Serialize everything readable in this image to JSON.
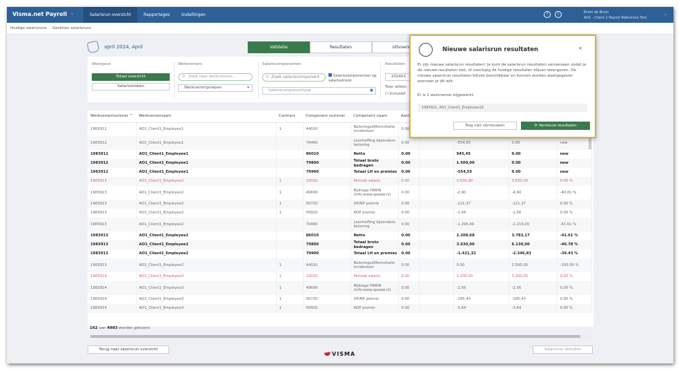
{
  "nav": {
    "brand": "Visma.net Payroll",
    "tabs": [
      "Salarisrun overzicht",
      "Rapportages",
      "Instellingen"
    ],
    "user_name": "Bram de Bruin",
    "user_company": "AO1 - Client 1 Payroll Reference Tool"
  },
  "subnav": [
    "Huidige salarisruns",
    "Gesloten salarisruns"
  ],
  "page": {
    "title": "april 2024, April",
    "tabs": [
      "Validatie",
      "Resultaten",
      "Uitvoering"
    ]
  },
  "filters": {
    "weergave_label": "Weergave",
    "totaal_btn": "Totaal overzicht",
    "salarisstroken_btn": "Salarisstroken",
    "werknemers_label": "Werknemers",
    "werknemers_placeholder": "Zoek naar werknemers...",
    "werknemergroepen": "Werknemergroepen",
    "componenten_label": "Salariscomponenten",
    "componenten_placeholder": "Zoek salariscomponent",
    "checkbox_label": "Salariscomponenten op salarisstrook",
    "componenttype_placeholder": "Salariscomponenttype",
    "resultaten_label": "Resultaten",
    "resultaten_value": "202403",
    "toon_label": "Toon alleen",
    "inclusief_label": "Inclusief"
  },
  "table": {
    "headers": [
      "Werknemernummer ^",
      "Werknemernaam",
      "Contract",
      "Component nummer",
      "Component naam",
      "Aant",
      "",
      "",
      "",
      "",
      ""
    ],
    "rows": [
      {
        "style": "r2",
        "cells": [
          "1983912",
          "AO1_Client1_Employee1",
          "1",
          "44010",
          "Beloningsdifferentiatie incidenteel",
          "0.00",
          "",
          "",
          "",
          "",
          ""
        ]
      },
      {
        "style": "r2",
        "cells": [
          "1983912",
          "AO1_Client1_Employee1",
          "",
          "70460",
          "Loonheffing bijzondere beloning",
          "0.00",
          "",
          "-554,55",
          "",
          "0.00",
          "new"
        ]
      },
      {
        "style": "r1 bold",
        "cells": [
          "1983912",
          "AO1_Client1_Employee1",
          "",
          "86010",
          "Netto",
          "0.00",
          "",
          "945,45",
          "",
          "0.00",
          "new"
        ]
      },
      {
        "style": "r1 bold",
        "cells": [
          "1983912",
          "AO1_Client1_Employee1",
          "",
          "79800",
          "Totaal bruto bedragen",
          "0.00",
          "",
          "1.500,00",
          "",
          "0.00",
          "new"
        ]
      },
      {
        "style": "r1 bold",
        "cells": [
          "1983912",
          "AO1_Client1_Employee1",
          "",
          "79900",
          "Totaal LH en premies",
          "0.00",
          "",
          "-554,55",
          "",
          "0.00",
          "new"
        ]
      },
      {
        "style": "r1 red",
        "cells": [
          "1983913",
          "AO1_Client1_Employee2",
          "1",
          "10010",
          "Periode salaris",
          "0.00",
          "",
          "3.630,00",
          "",
          "3.630,00",
          "0.00 %"
        ]
      },
      {
        "style": "r2",
        "cells": [
          "1983913",
          "AO1_Client1_Employee2",
          "1",
          "49690",
          "Bijdrage FAWW (info:www.spaww.nl)",
          "0.00",
          "",
          "-2,90",
          "",
          "-4,90",
          "-40.81 %"
        ]
      },
      {
        "style": "r1",
        "cells": [
          "1983913",
          "AO1_Client1_Employee2",
          "1",
          "50720",
          "OP/NP premie",
          "0.00",
          "",
          "-121,37",
          "",
          "-121,37",
          "0.00 %"
        ]
      },
      {
        "style": "r1",
        "cells": [
          "1983913",
          "AO1_Client1_Employee2",
          "1",
          "50920",
          "AOP premie",
          "0.00",
          "",
          "-1,56",
          "",
          "-1,56",
          "0.00 %"
        ]
      },
      {
        "style": "r2",
        "cells": [
          "1983913",
          "AO1_Client1_Employee2",
          "",
          "70460",
          "Loonheffing bijzondere beloning",
          "0.00",
          "",
          "-1.295,49",
          "",
          "-2.219,00",
          "-41.61 %"
        ]
      },
      {
        "style": "r1 bold",
        "cells": [
          "1983913",
          "AO1_Client1_Employee2",
          "",
          "86010",
          "Netto",
          "0.00",
          "",
          "2.208,68",
          "",
          "3.783,17",
          "-41.61 %"
        ]
      },
      {
        "style": "r1 bold",
        "cells": [
          "1983913",
          "AO1_Client1_Employee2",
          "",
          "79800",
          "Totaal bruto bedragen",
          "0.00",
          "",
          "3.630,00",
          "",
          "6.130,00",
          "-40.78 %"
        ]
      },
      {
        "style": "r1 bold",
        "cells": [
          "1983913",
          "AO1_Client1_Employee2",
          "",
          "79900",
          "Totaal LH en premies",
          "0.00",
          "",
          "-1.421,32",
          "",
          "-2.346,83",
          "-39.43 %"
        ]
      },
      {
        "style": "r2",
        "cells": [
          "1983913",
          "AO1_Client1_Employee2",
          "1",
          "44010",
          "Beloningsdifferentiatie incidenteel",
          "0.00",
          "",
          "0.00",
          "",
          "2.500,00",
          "-100.00 %"
        ]
      },
      {
        "style": "r1 red",
        "cells": [
          "1983914",
          "AO1_Client1_Employee3",
          "1",
          "10010",
          "Periode salaris",
          "0.00",
          "",
          "3.200,00",
          "",
          "3.200,00",
          "0.00 %"
        ]
      },
      {
        "style": "r2",
        "cells": [
          "1983914",
          "AO1_Client1_Employee3",
          "1",
          "49690",
          "Bijdrage FAWW (info:www.spaww.nl)",
          "0.00",
          "",
          "-2,56",
          "",
          "-2,56",
          "0.00 %"
        ]
      },
      {
        "style": "r1",
        "cells": [
          "1983914",
          "AO1_Client1_Employee3",
          "1",
          "50720",
          "OP/NP premie",
          "0.00",
          "",
          "-185,43",
          "",
          "-185,43",
          "0.00 %"
        ]
      },
      {
        "style": "r1",
        "cells": [
          "1983914",
          "AO1_Client1_Employee3",
          "1",
          "50920",
          "AOP premie",
          "0.00",
          "",
          "-3,64",
          "",
          "-3,64",
          "0.00 %"
        ]
      }
    ],
    "count_shown": "162",
    "count_mid": "van",
    "count_total": "4983",
    "count_suffix": "worden getoond"
  },
  "footer": {
    "back_btn": "Terug naar salarisrun overzicht",
    "close_btn": "Salarisrun afsluiten",
    "logo": "VISMA"
  },
  "modal": {
    "title": "Nieuwe salarisrun resultaten",
    "body": "Er zijn nieuwe salarisrun resultaten! Je kunt de salarisrun resultaten vernieuwen zodat je de nieuwe resultaten ziet, of voorlopig de huidige resultaten blijven weergeven. De nieuwe salarisrun resultaten blijven beschikbaar en kunnen worden weergegeven wanneer je dit wilt.",
    "updated": "Er is 1 werknemer bijgewerkt.",
    "employee": "1983921, AO1_Client1_Employee10",
    "later_btn": "Nog niet vernieuwen",
    "refresh_btn": "Vernieuw resultaten"
  },
  "colors": {
    "nav": "#2e6098",
    "green": "#3b7a4c",
    "highlight": "#e0ad2c",
    "red_row": "#d45a6e"
  }
}
